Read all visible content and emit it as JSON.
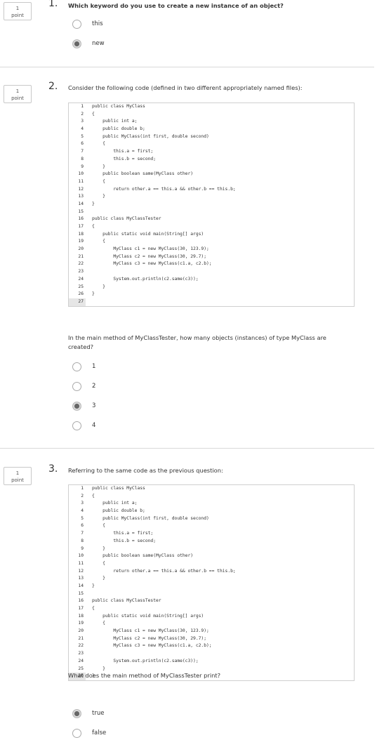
{
  "questions": [
    {
      "points": "1",
      "points_unit": "point",
      "number": "1.",
      "prompt": "Which keyword do you use to create a new instance of an object?",
      "options": [
        {
          "label": "this",
          "selected": false
        },
        {
          "label": "new",
          "selected": true
        }
      ]
    },
    {
      "points": "1",
      "points_unit": "point",
      "number": "2.",
      "prompt": "Consider the following code (defined in two different appropriately named files):",
      "code_lines": [
        "public class MyClass",
        "{",
        "    public int a;",
        "    public double b;",
        "    public MyClass(int first, double second)",
        "    {",
        "        this.a = first;",
        "        this.b = second;",
        "    }",
        "    public boolean same(MyClass other)",
        "    {",
        "        return other.a == this.a && other.b == this.b;",
        "    }",
        "}",
        "",
        "public class MyClassTester",
        "{",
        "    public static void main(String[] args)",
        "    {",
        "        MyClass c1 = new MyClass(30, 123.9);",
        "        MyClass c2 = new MyClass(30, 29.7);",
        "        MyClass c3 = new MyClass(c1.a, c2.b);",
        "",
        "        System.out.println(c2.same(c3));",
        "    }",
        "}",
        ""
      ],
      "followup": "In the main method of MyClassTester, how many objects (instances) of type MyClass are created?",
      "options": [
        {
          "label": "1",
          "selected": false
        },
        {
          "label": "2",
          "selected": false
        },
        {
          "label": "3",
          "selected": true
        },
        {
          "label": "4",
          "selected": false
        }
      ]
    },
    {
      "points": "1",
      "points_unit": "point",
      "number": "3.",
      "prompt": "Referring to the same code as the previous question:",
      "code_lines": [
        "public class MyClass",
        "{",
        "    public int a;",
        "    public double b;",
        "    public MyClass(int first, double second)",
        "    {",
        "        this.a = first;",
        "        this.b = second;",
        "    }",
        "    public boolean same(MyClass other)",
        "    {",
        "        return other.a == this.a && other.b == this.b;",
        "    }",
        "}",
        "",
        "public class MyClassTester",
        "{",
        "    public static void main(String[] args)",
        "    {",
        "        MyClass c1 = new MyClass(30, 123.9);",
        "        MyClass c2 = new MyClass(30, 29.7);",
        "        MyClass c3 = new MyClass(c1.a, c2.b);",
        "",
        "        System.out.println(c2.same(c3));",
        "    }",
        "}"
      ],
      "followup": "What does the main method of MyClassTester print?",
      "options": [
        {
          "label": "true",
          "selected": true
        },
        {
          "label": "false",
          "selected": false
        }
      ]
    }
  ]
}
